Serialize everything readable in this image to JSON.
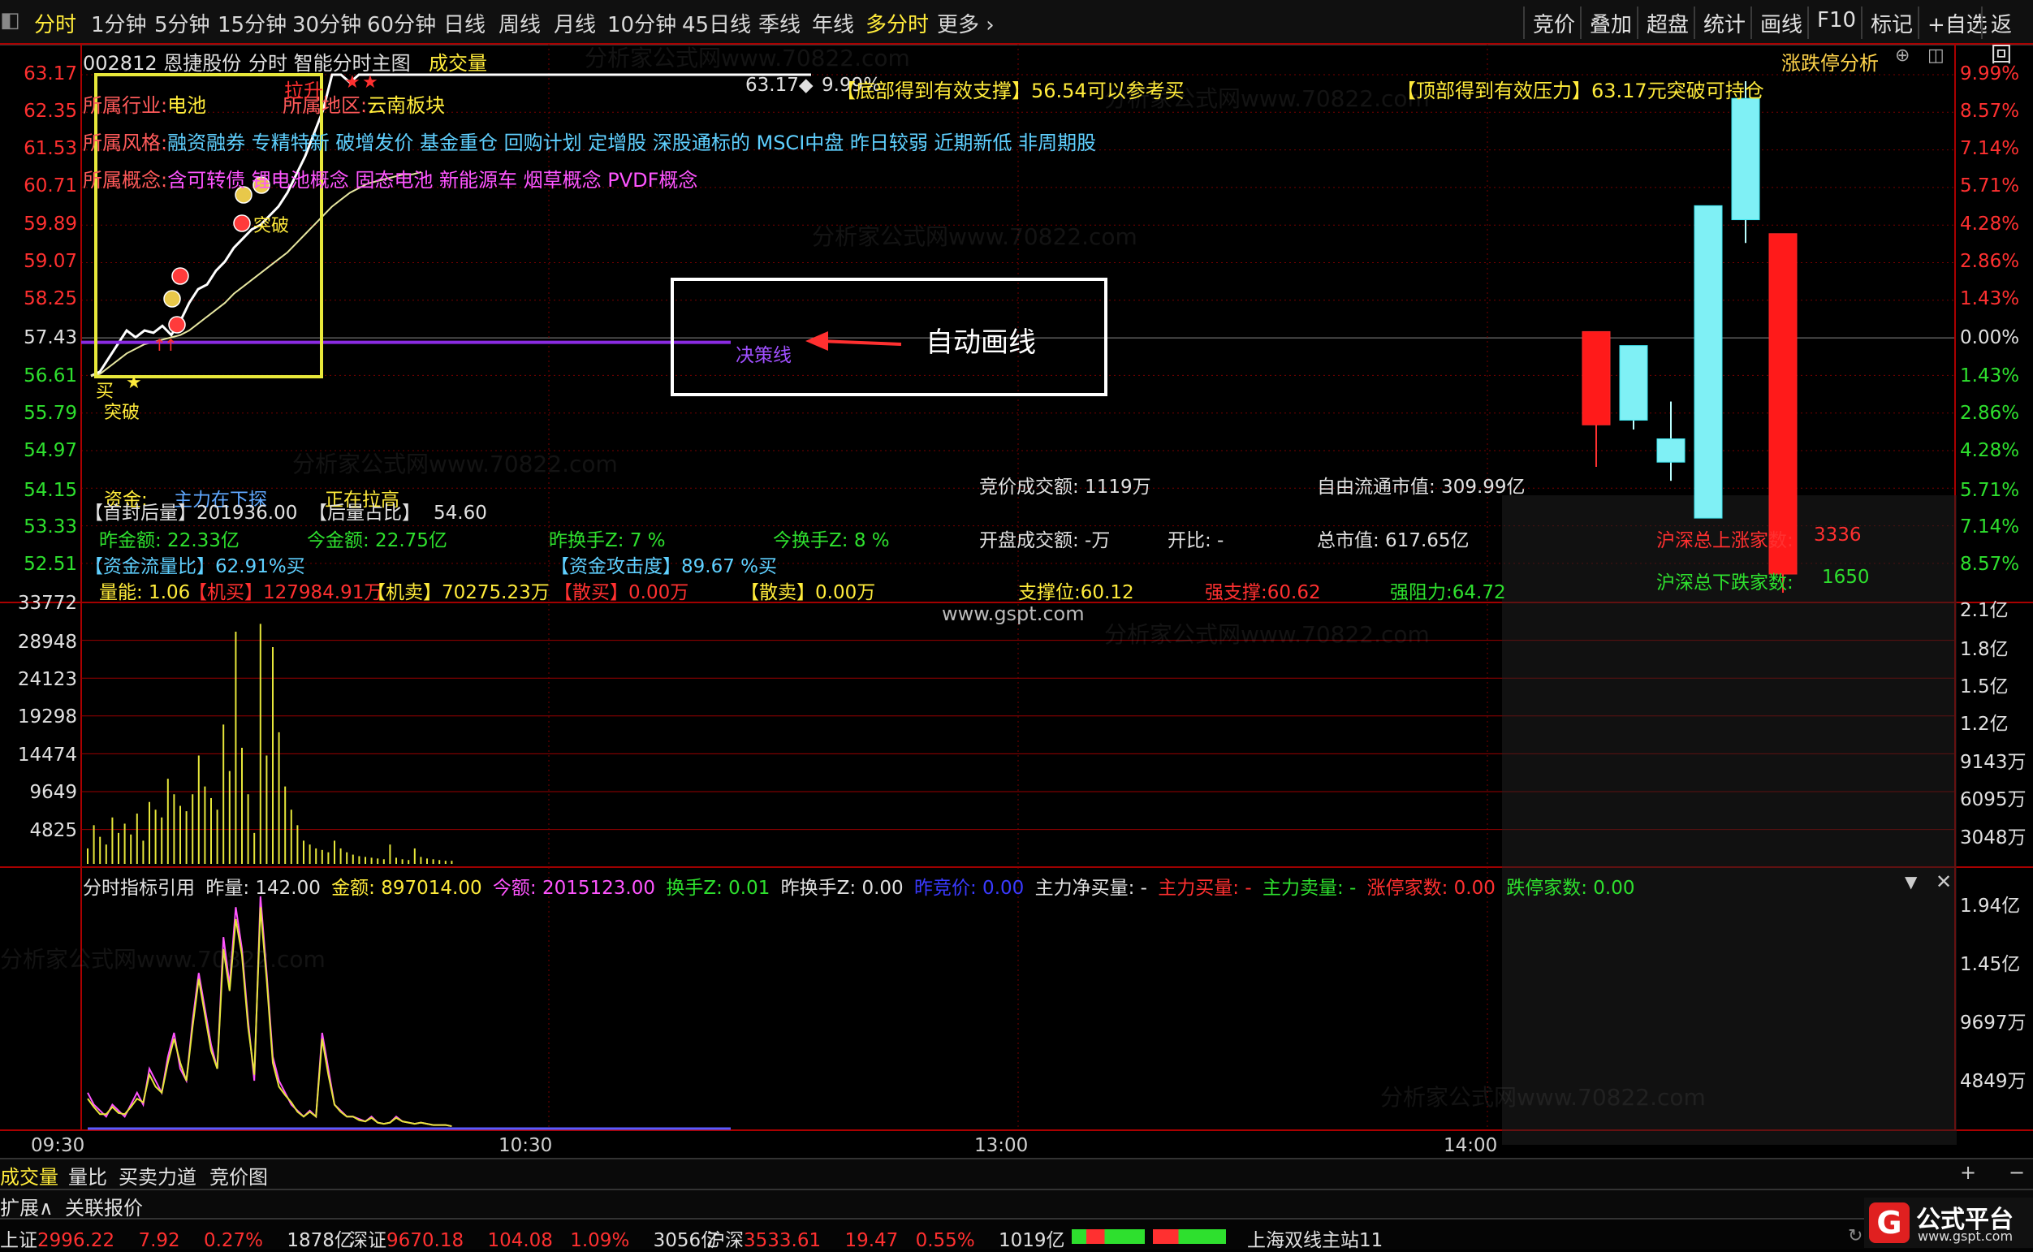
{
  "toolbar": {
    "periods": [
      "分时",
      "1分钟",
      "5分钟",
      "15分钟",
      "30分钟",
      "60分钟",
      "日线",
      "周线",
      "月线",
      "10分钟",
      "45日线",
      "季线",
      "年线",
      "多分时",
      "更多"
    ],
    "right": [
      "竞价",
      "叠加",
      "超盘",
      "统计",
      "画线",
      "F10",
      "标记",
      "+自选",
      "返回"
    ]
  },
  "stock": {
    "code_name": "002812 恩捷股份",
    "view": "分时 智能分时主图",
    "volume_tab": "成交量",
    "limit_analysis": "涨跌停分析"
  },
  "price_axis_left": [
    "63.17",
    "62.35",
    "61.53",
    "60.71",
    "59.89",
    "59.07",
    "58.25",
    "57.43",
    "56.61",
    "55.79",
    "54.97",
    "54.15",
    "53.33",
    "52.51"
  ],
  "pct_axis_right": [
    "9.99%",
    "8.57%",
    "7.14%",
    "5.71%",
    "4.28%",
    "2.86%",
    "1.43%",
    "0.00%",
    "1.43%",
    "2.86%",
    "4.28%",
    "5.71%",
    "7.14%",
    "8.57%"
  ],
  "volume_axis_left": [
    "33772",
    "28948",
    "24123",
    "19298",
    "14474",
    "9649",
    "4825"
  ],
  "volume_axis_right": [
    "2.1亿",
    "1.8亿",
    "1.5亿",
    "1.2亿",
    "9143万",
    "6095万",
    "3048万"
  ],
  "indicator_axis_right": [
    "1.94亿",
    "1.45亿",
    "9697万",
    "4849万"
  ],
  "time_axis": [
    "09:30",
    "10:30",
    "13:00",
    "14:00"
  ],
  "info": {
    "industry_label": "所属行业:",
    "industry": "电池",
    "region_label": "所属地区:",
    "region": "云南板块",
    "style_label": "所属风格:",
    "style": "融资融券 专精特新 破增发价 基金重仓 回购计划 定增股 深股通标的 MSCI中盘 昨日较弱 近期新低 非周期股",
    "concept_label": "所属概念:",
    "concept": "含可转债 锂电池概念 固态电池 新能源车 烟草概念 PVDF概念",
    "support_msg": "【底部得到有效支撑】56.54可以参考买",
    "pressure_msg": "【顶部得到有效压力】63.17元突破可持仓",
    "price_mark": "63.17◆",
    "pct_mark": "9.99%",
    "lashen": "拉升",
    "tupo1": "突破",
    "mai": "买",
    "tupo2": "突破",
    "decision_line": "决策线"
  },
  "annotation": {
    "text": "自动画线"
  },
  "stats": {
    "fund_label": "资金:",
    "fund_value": "主力在下探",
    "fund_status": "正在拉高",
    "seal_label": "【首封后量】",
    "seal_value": "201936.00",
    "seal_ratio_label": "【后量占比】",
    "seal_ratio_value": "54.60",
    "auction_amount": "竞价成交额: 1119万",
    "free_cap": "自由流通市值: 309.99亿",
    "yest_amount": "昨金额: 22.33亿",
    "today_amount": "今金额: 22.75亿",
    "yest_turnover": "昨换手Z: 7 %",
    "today_turnover": "今换手Z: 8 %",
    "open_amount": "开盘成交额: -万",
    "open_ratio": "开比: -",
    "total_cap": "总市值: 617.65亿",
    "up_label": "沪深总上涨家数:",
    "up_value": "3336",
    "down_label": "沪深总下跌家数:",
    "down_value": "1650",
    "flow_ratio": "【资金流量比】62.91%买",
    "attack": "【资金攻击度】89.67 %买",
    "vol_ratio": "量能: 1.06",
    "inst_buy": "【机买】127984.91万",
    "inst_sell": "【机卖】70275.23万",
    "retail_buy": "【散买】0.00万",
    "retail_sell": "【散卖】0.00万",
    "support": "支撑位:60.12",
    "strong_support": "强支撑:60.62",
    "strong_resist": "强阻力:64.72"
  },
  "watermark": {
    "site": "www.gspt.com",
    "text": "分析家公式网www.70822.com"
  },
  "indicator_header": {
    "name": "分时指标引用",
    "yest_vol": "昨量: 142.00",
    "amount": "金额: 897014.00",
    "today_vol": "今额: 2015123.00",
    "turnover": "换手Z: 0.01",
    "yest_turnover": "昨换手Z: 0.00",
    "yest_price": "昨竞价: 0.00",
    "net_buy": "主力净买量: -",
    "main_buy": "主力买量: -",
    "main_sell": "主力卖量: -",
    "limit_up": "涨停家数: 0.00",
    "limit_down": "跌停家数: 0.00"
  },
  "bottom_tabs": [
    "成交量",
    "量比",
    "买卖力道",
    "竞价图"
  ],
  "bottom_tabs2": [
    "扩展∧",
    "关联报价"
  ],
  "status_bar": {
    "sh_label": "上证",
    "sh_value": "2996.22",
    "sh_change": "7.92",
    "sh_pct": "0.27%",
    "sh_amount": "1878亿",
    "sz_label": "深证",
    "sz_value": "9670.18",
    "sz_change": "104.08",
    "sz_pct": "1.09%",
    "sz_amount": "3056亿",
    "hs_label": "沪深",
    "hs_value": "3533.61",
    "hs_change": "19.47",
    "hs_pct": "0.55%",
    "hs_amount": "1019亿",
    "station": "上海双线主站11",
    "logo": "公式平台",
    "logo_sub": "www.gspt.com"
  },
  "colors": {
    "up": "#ff2a2a",
    "down": "#3de5ef",
    "avg": "#e6e6a0",
    "decision": "#8a2be2",
    "grid": "#aa0000"
  },
  "chart_data": {
    "price_line": [
      56.61,
      56.7,
      57.0,
      57.3,
      57.6,
      57.45,
      57.6,
      57.55,
      57.7,
      57.5,
      57.8,
      58.2,
      58.5,
      58.6,
      58.9,
      59.1,
      59.4,
      59.6,
      59.8,
      59.9,
      60.1,
      60.3,
      60.6,
      61.0,
      61.4,
      61.9,
      62.4,
      63.17,
      63.17,
      63.0,
      63.17,
      63.17,
      63.17,
      63.17,
      63.17,
      63.17,
      63.17,
      63.17
    ],
    "avg_line": [
      56.61,
      56.65,
      56.8,
      56.95,
      57.1,
      57.2,
      57.3,
      57.35,
      57.4,
      57.45,
      57.5,
      57.6,
      57.75,
      57.9,
      58.05,
      58.2,
      58.4,
      58.55,
      58.7,
      58.85,
      59.0,
      59.15,
      59.3,
      59.5,
      59.7,
      59.9,
      60.1,
      60.3,
      60.45,
      60.6,
      60.7,
      60.8,
      60.85,
      60.9,
      60.95,
      61.0,
      61.0,
      61.05
    ],
    "volume": [
      2000,
      5000,
      3500,
      2500,
      6000,
      4000,
      5200,
      3800,
      6500,
      3000,
      8000,
      7000,
      6000,
      11000,
      9000,
      7500,
      6800,
      9000,
      14000,
      10000,
      8500,
      7000,
      18000,
      12000,
      30000,
      15000,
      9000,
      4000,
      31000,
      14000,
      28000,
      17000,
      10000,
      7000,
      5000,
      3000,
      2500,
      2000,
      1800,
      1500,
      3000,
      2000,
      1500,
      1200,
      1000,
      900,
      800,
      700,
      600,
      2500,
      800,
      600,
      500,
      2000,
      900,
      700,
      600,
      500,
      400,
      400
    ],
    "indicator_a": [
      0.3,
      0.2,
      0.15,
      0.1,
      0.2,
      0.15,
      0.1,
      0.2,
      0.3,
      0.2,
      0.5,
      0.4,
      0.3,
      0.6,
      0.8,
      0.5,
      0.4,
      0.9,
      1.3,
      1.0,
      0.7,
      0.5,
      1.6,
      1.2,
      1.85,
      1.5,
      0.9,
      0.4,
      1.94,
      1.3,
      0.6,
      0.4,
      0.3,
      0.2,
      0.15,
      0.1,
      0.15,
      0.1,
      0.8,
      0.5,
      0.2,
      0.15,
      0.1,
      0.1,
      0.08,
      0.06,
      0.1,
      0.05,
      0.04,
      0.05,
      0.1,
      0.06,
      0.05,
      0.04,
      0.05,
      0.04,
      0.03,
      0.03,
      0.03,
      0.02
    ],
    "indicator_b": [
      0.25,
      0.18,
      0.12,
      0.12,
      0.18,
      0.13,
      0.12,
      0.18,
      0.25,
      0.22,
      0.45,
      0.35,
      0.3,
      0.55,
      0.75,
      0.55,
      0.4,
      0.85,
      1.25,
      0.95,
      0.65,
      0.5,
      1.5,
      1.15,
      1.75,
      1.45,
      0.85,
      0.45,
      1.85,
      1.25,
      0.55,
      0.35,
      0.28,
      0.22,
      0.14,
      0.1,
      0.14,
      0.1,
      0.75,
      0.45,
      0.2,
      0.14,
      0.1,
      0.1,
      0.07,
      0.06,
      0.09,
      0.05,
      0.04,
      0.05,
      0.09,
      0.06,
      0.05,
      0.04,
      0.05,
      0.04,
      0.03,
      0.03,
      0.03,
      0.02
    ],
    "candles": [
      {
        "open": 57.8,
        "close": 55.8,
        "high": 57.8,
        "low": 54.9
      },
      {
        "open": 55.9,
        "close": 57.5,
        "high": 57.5,
        "low": 55.7
      },
      {
        "open": 55.0,
        "close": 55.5,
        "high": 56.3,
        "low": 54.6
      },
      {
        "open": 53.8,
        "close": 60.5,
        "high": 60.5,
        "low": 53.8
      },
      {
        "open": 60.2,
        "close": 62.8,
        "high": 63.17,
        "low": 59.7
      },
      {
        "open": 59.9,
        "close": 52.6,
        "high": 59.9,
        "low": 52.2
      }
    ]
  }
}
